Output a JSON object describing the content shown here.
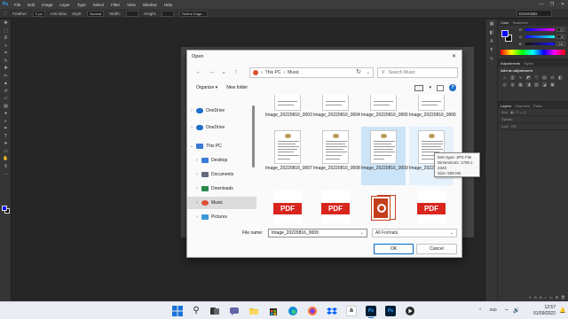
{
  "photoshop": {
    "logo": "Ps",
    "menu": [
      "File",
      "Edit",
      "Image",
      "Layer",
      "Type",
      "Select",
      "Filter",
      "View",
      "Window",
      "Help"
    ],
    "window_controls": [
      "—",
      "❐",
      "✕"
    ],
    "options": {
      "feather_label": "Feather:",
      "feather_value": "0 px",
      "antialias_label": "Anti-alias",
      "style_label": "Style:",
      "style_value": "Normal",
      "width_label": "Width:",
      "height_label": "Height:",
      "refine_label": "Refine Edge...",
      "workspace": "Essentials"
    },
    "color_panel": {
      "tabs": [
        "Color",
        "Swatches"
      ],
      "channels": [
        {
          "label": "R",
          "value": "21"
        },
        {
          "label": "G",
          "value": "19"
        },
        {
          "label": "B",
          "value": "242"
        }
      ],
      "foreground": "#0000ff",
      "background": "#000000"
    },
    "adjustments_panel": {
      "tabs": [
        "Adjustments",
        "Styles"
      ],
      "heading": "Add an adjustment"
    },
    "layers_panel": {
      "tabs": [
        "Layers",
        "Channels",
        "Paths"
      ],
      "kind_label": "Kind",
      "opacity_label": "Opacity:",
      "lock_label": "Lock:",
      "fill_label": "Fill:"
    }
  },
  "dialog": {
    "title": "Open",
    "close": "✕",
    "nav_back": "←",
    "nav_forward": "→",
    "nav_recent": "⌄",
    "nav_up": "↑",
    "breadcrumb": [
      "This PC",
      "Music"
    ],
    "breadcrumb_sep": "›",
    "search_placeholder": "Search Music",
    "organize": "Organize ▾",
    "new_folder": "New folder",
    "help": "?",
    "nav_items": [
      {
        "label": "OneDrive",
        "icon": "cloud-icon",
        "color": "#1e6fc9"
      },
      {
        "label": "OneDrive",
        "icon": "cloud-icon",
        "color": "#1e6fc9"
      },
      {
        "label": "This PC",
        "icon": "computer-icon",
        "color": "#3a7bd5"
      },
      {
        "label": "Desktop",
        "icon": "desktop-folder-icon",
        "color": "#3a7bd5"
      },
      {
        "label": "Documents",
        "icon": "documents-folder-icon",
        "color": "#5f6b7a"
      },
      {
        "label": "Downloads",
        "icon": "downloads-folder-icon",
        "color": "#2a8a4a"
      },
      {
        "label": "Music",
        "icon": "music-folder-icon",
        "color": "#e04f33"
      },
      {
        "label": "Pictures",
        "icon": "pictures-folder-icon",
        "color": "#3a9ad9"
      }
    ],
    "files_row0": [
      "Image_20220816_0003",
      "Image_20220816_0004",
      "Image_20220816_0005",
      "Image_20220816_0006"
    ],
    "files_row1": [
      "Image_20220816_0007",
      "Image_20220816_0008",
      "Image_20220816_0009",
      "Image_20220816_0010"
    ],
    "row2_types": [
      "pdf",
      "pdf",
      "ppt",
      "pdf"
    ],
    "pdf_label": "PDF",
    "tooltip": {
      "type": "Item type: JPG File",
      "dimensions": "Dimensions: 1700 x 2340",
      "size": "Size: 509 KB"
    },
    "file_name_label": "File name:",
    "file_name_value": "Image_20220816_0009",
    "format_value": "All Formats",
    "ok": "OK",
    "cancel": "Cancel"
  },
  "taskbar": {
    "tray_lang": "IND",
    "time": "12:57",
    "date": "01/09/2022",
    "tray_chevron": "^"
  }
}
